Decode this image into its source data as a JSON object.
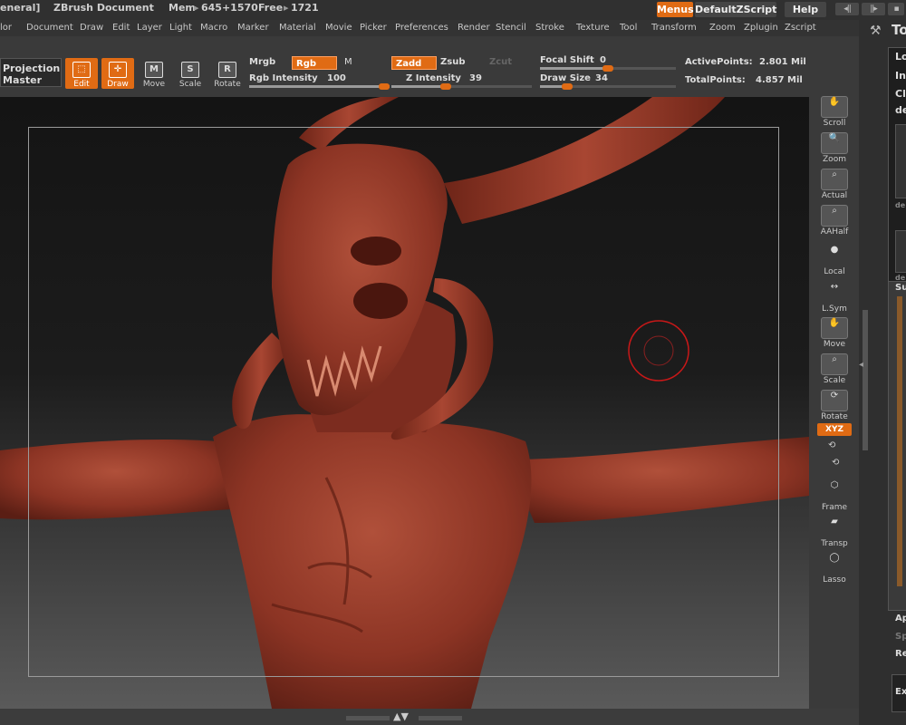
{
  "titlebar": {
    "menu_fragment": "eneral]",
    "doc_title": "ZBrush Document",
    "mem_label": "Mem",
    "mem_value": "645+1570",
    "free_label": "Free",
    "free_value": "1721",
    "menus_button": "Menus",
    "script_button": "DefaultZScript",
    "help_button": "Help"
  },
  "menubar": {
    "items": [
      "lor",
      "Document",
      "Draw",
      "Edit",
      "Layer",
      "Light",
      "Macro",
      "Marker",
      "Material",
      "Movie",
      "Picker",
      "Preferences",
      "Render",
      "Stencil",
      "Stroke",
      "Texture",
      "Tool",
      "Transform",
      "Zoom",
      "Zplugin",
      "Zscript"
    ]
  },
  "toolbar": {
    "projection_master": [
      "Projection",
      "Master"
    ],
    "edit_label": "Edit",
    "draw_label": "Draw",
    "move_label": "Move",
    "scale_label": "Scale",
    "rotate_label": "Rotate",
    "move_key": "M",
    "scale_key": "S",
    "rotate_key": "R",
    "mrgb": "Mrgb",
    "rgb": "Rgb",
    "m": "M",
    "rgb_intensity_label": "Rgb Intensity",
    "rgb_intensity_value": "100",
    "zadd": "Zadd",
    "zsub": "Zsub",
    "zcut": "Zcut",
    "z_intensity_label": "Z Intensity",
    "z_intensity_value": "39",
    "focal_shift_label": "Focal Shift",
    "focal_shift_value": "0",
    "draw_size_label": "Draw Size",
    "draw_size_value": "34",
    "active_points_label": "ActivePoints:",
    "active_points_value": "2.801",
    "active_points_unit": "Mil",
    "total_points_label": "TotalPoints:",
    "total_points_value": "4.857",
    "total_points_unit": "Mil",
    "rgb_intensity_fraction": 1.0,
    "z_intensity_fraction": 0.39,
    "focal_shift_fraction": 0.5,
    "draw_size_fraction": 0.2
  },
  "shelf": {
    "items": [
      "Scroll",
      "Zoom",
      "Actual",
      "AAHalf",
      "Local",
      "L.Sym",
      "Move",
      "Scale",
      "Rotate",
      "XYZ",
      "Frame",
      "Transp",
      "Lasso"
    ]
  },
  "rpanel": {
    "title_fragment": "To",
    "lo": "Lo",
    "in": "In",
    "cl": "Cl",
    "de": "de",
    "de2": "de",
    "de3": "de",
    "su": "Su",
    "ap": "Ap",
    "sp": "Sp",
    "re": "Re",
    "ex": "Ex"
  },
  "colors": {
    "accent": "#e06b14",
    "model": "#8c3424",
    "brush_ring": "#c81818"
  }
}
